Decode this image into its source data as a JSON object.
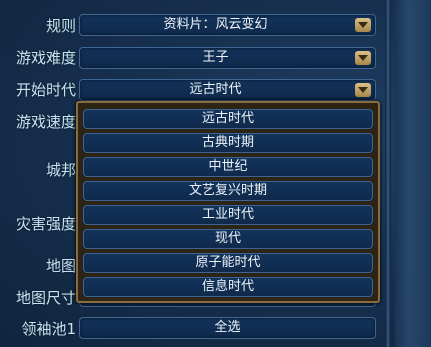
{
  "rows": [
    {
      "label": "规则",
      "value": "资料片：风云变幻"
    },
    {
      "label": "游戏难度",
      "value": "王子"
    },
    {
      "label": "开始时代",
      "value": "远古时代"
    },
    {
      "label": "游戏速度",
      "value": ""
    },
    {
      "label": "城邦",
      "value": ""
    },
    {
      "label": "灾害强度",
      "value": ""
    },
    {
      "label": "地图",
      "value": ""
    },
    {
      "label": "地图尺寸",
      "value": ""
    },
    {
      "label": "领袖池1",
      "value": "全选"
    }
  ],
  "era_dropdown": {
    "options": [
      "远古时代",
      "古典时期",
      "中世纪",
      "文艺复兴时期",
      "工业时代",
      "现代",
      "原子能时代",
      "信息时代"
    ],
    "selected": "远古时代"
  },
  "icons": {
    "dropdown_arrow": "chevron-down-icon"
  }
}
